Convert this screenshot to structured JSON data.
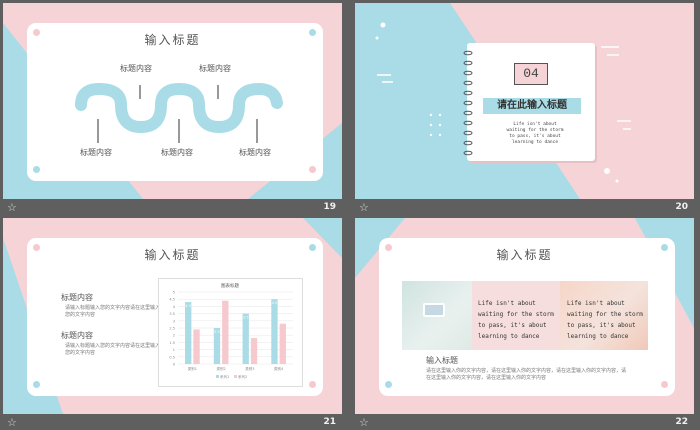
{
  "colors": {
    "pink": "#f5d3d6",
    "blue": "#a9dce6",
    "bar_blue": "#a9dce6",
    "bar_pink": "#f5c9cd",
    "footer_bg": "#5f5f5f"
  },
  "slides": [
    {
      "number": "19",
      "title": "输入标题",
      "labels_top": [
        "标题内容",
        "标题内容"
      ],
      "labels_bottom": [
        "标题内容",
        "标题内容",
        "标题内容"
      ],
      "icons": [
        "note-icon",
        "camera-icon",
        "cloud-icon",
        "gear-icon",
        "clock-icon"
      ]
    },
    {
      "number": "20",
      "section_number": "04",
      "heading": "请在此输入标题",
      "quote": "Life isn't about waiting for the storm to pass, it's about learning to dance"
    },
    {
      "number": "21",
      "title": "输入标题",
      "items": [
        {
          "heading": "标题内容",
          "body": "请输入标题输入您的文字内容请在这里输入您的文字内容"
        },
        {
          "heading": "标题内容",
          "body": "请输入标题输入您的文字内容请在这里输入您的文字内容"
        }
      ],
      "chart_data": {
        "type": "bar",
        "title": "图表标题",
        "categories": [
          "类别1",
          "类别2",
          "类别3",
          "类别4"
        ],
        "series": [
          {
            "values": [
              4.3,
              2.5,
              3.5,
              4.5
            ],
            "color": "#a9dce6"
          },
          {
            "values": [
              2.4,
              4.4,
              1.8,
              2.8
            ],
            "color": "#f5c9cd"
          }
        ],
        "ylim": [
          0,
          5
        ],
        "yticks": [
          "0",
          "0.5",
          "1",
          "1.5",
          "2",
          "2.5",
          "3",
          "3.5",
          "4",
          "4.5",
          "5"
        ],
        "data_labels": [
          "4.3",
          "2.5",
          "3.5",
          "4.5"
        ],
        "legend": [
          "系列1",
          "系列2"
        ],
        "grid": true
      }
    },
    {
      "number": "22",
      "title": "输入标题",
      "quote_left": "Life isn't about waiting for the storm to pass, it's about learning to dance",
      "quote_right": "Life isn't about waiting for the storm to pass, it's about learning to dance",
      "subheading": "输入标题",
      "body": "请在这里输入你的文字内容，请在这里输入你的文字内容，请在这里输入你的文字内容，请在这里输入你的文字内容，请在这里输入你的文字内容"
    }
  ],
  "star_glyph": "☆"
}
